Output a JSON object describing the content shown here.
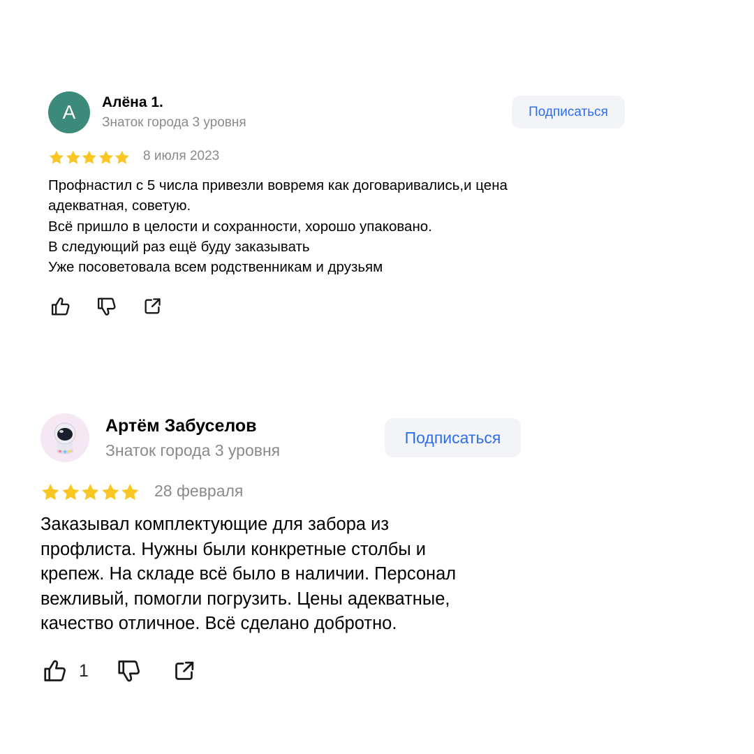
{
  "colors": {
    "accent": "#2e6fe8",
    "star": "#f9c623",
    "muted": "#8a8a8a",
    "avatar_bg": "#3c8a79",
    "button_bg": "#f3f4f8"
  },
  "reviews": [
    {
      "avatar_letter": "А",
      "author": "Алёна 1.",
      "level": "Знаток города 3 уровня",
      "subscribe_label": "Подписаться",
      "rating": 5,
      "date": "8 июля 2023",
      "text_lines": [
        "Профнастил с 5 числа привезли вовремя как договаривались,и цена",
        "адекватная, советую.",
        "Всё пришло в целости и сохранности, хорошо упаковано.",
        "В следующий раз ещё буду заказывать",
        "Уже посоветовала всем родственникам и друзьям"
      ],
      "icons": [
        "thumbs-up-icon",
        "thumbs-down-icon",
        "share-icon"
      ]
    },
    {
      "avatar_icon": "astronaut-avatar-icon",
      "author": "Артём Забуселов",
      "level": "Знаток города 3 уровня",
      "subscribe_label": "Подписаться",
      "rating": 5,
      "date": "28 февраля",
      "text_lines": [
        "Заказывал комплектующие для забора из",
        "профлиста. Нужны были конкретные столбы и",
        "крепеж. На складе всё было в наличии. Персонал",
        "вежливый, помогли погрузить. Цены адекватные,",
        "качество отличное. Всё сделано добротно."
      ],
      "likes": "1",
      "icons": [
        "thumbs-up-icon",
        "thumbs-down-icon",
        "share-icon"
      ]
    }
  ]
}
